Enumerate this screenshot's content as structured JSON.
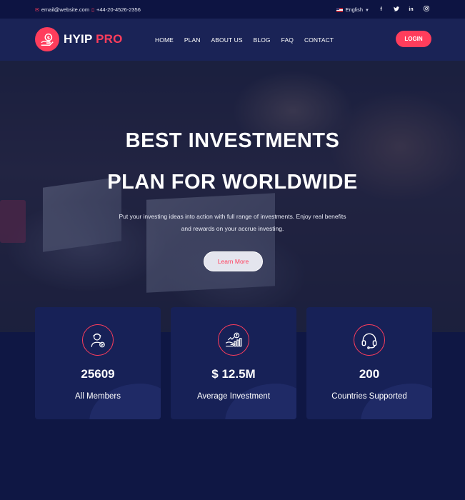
{
  "topbar": {
    "email": "email@website.com",
    "phone": "+44-20-4526-2356",
    "language": "English",
    "social_icons": [
      "facebook-icon",
      "twitter-icon",
      "linkedin-icon",
      "instagram-icon"
    ]
  },
  "logo": {
    "part1": "HYIP",
    "part2": "PRO",
    "badge_symbol": "$"
  },
  "nav": {
    "items": [
      "HOME",
      "PLAN",
      "ABOUT US",
      "BLOG",
      "FAQ",
      "CONTACT"
    ],
    "login_label": "LOGIN"
  },
  "hero": {
    "title_line1": "BEST INVESTMENTS",
    "title_line2": "PLAN FOR WORLDWIDE",
    "description_line1": "Put your investing ideas into action with full range of investments. Enjoy real benefits",
    "description_line2": "and rewards on your accrue investing.",
    "cta_label": "Learn More"
  },
  "stats": [
    {
      "icon": "member-icon",
      "value": "25609",
      "label": "All Members"
    },
    {
      "icon": "investment-icon",
      "value": "$ 12.5M",
      "label": "Average Investment"
    },
    {
      "icon": "headset-icon",
      "value": "200",
      "label": "Countries Supported"
    }
  ],
  "colors": {
    "accent": "#ff3d5c",
    "background": "#0f1744",
    "header": "#1a2356",
    "card": "#172157"
  }
}
